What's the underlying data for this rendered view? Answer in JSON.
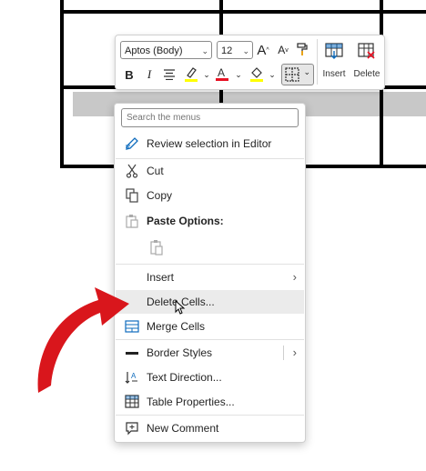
{
  "toolbar": {
    "font_name": "Aptos (Body)",
    "font_size": "12",
    "bold": "B",
    "italic": "I",
    "insert_label": "Insert",
    "delete_label": "Delete",
    "font_color": "#e81123",
    "highlight_color": "#ffff00"
  },
  "menu": {
    "search_placeholder": "Search the menus",
    "items": {
      "review": "Review selection in Editor",
      "cut": "Cut",
      "copy": "Copy",
      "paste_options": "Paste Options:",
      "insert": "Insert",
      "delete_cells": "Delete Cells...",
      "merge_cells": "Merge Cells",
      "border_styles": "Border Styles",
      "text_direction": "Text Direction...",
      "table_properties": "Table Properties...",
      "new_comment": "New Comment"
    }
  },
  "colors": {
    "accent": "#0f6cbd",
    "arrow": "#d9161c",
    "menu_hover": "#ebebeb",
    "table_border": "#000000",
    "cell_selection": "#c8c8c8"
  },
  "icons": [
    "pen-icon",
    "scissors-icon",
    "copy-icon",
    "paste-icon",
    "merge-cells-icon",
    "border-style-icon",
    "text-direction-icon",
    "table-properties-icon",
    "comment-icon",
    "chevron-right-icon",
    "insert-table-icon",
    "delete-table-icon",
    "borders-icon"
  ]
}
